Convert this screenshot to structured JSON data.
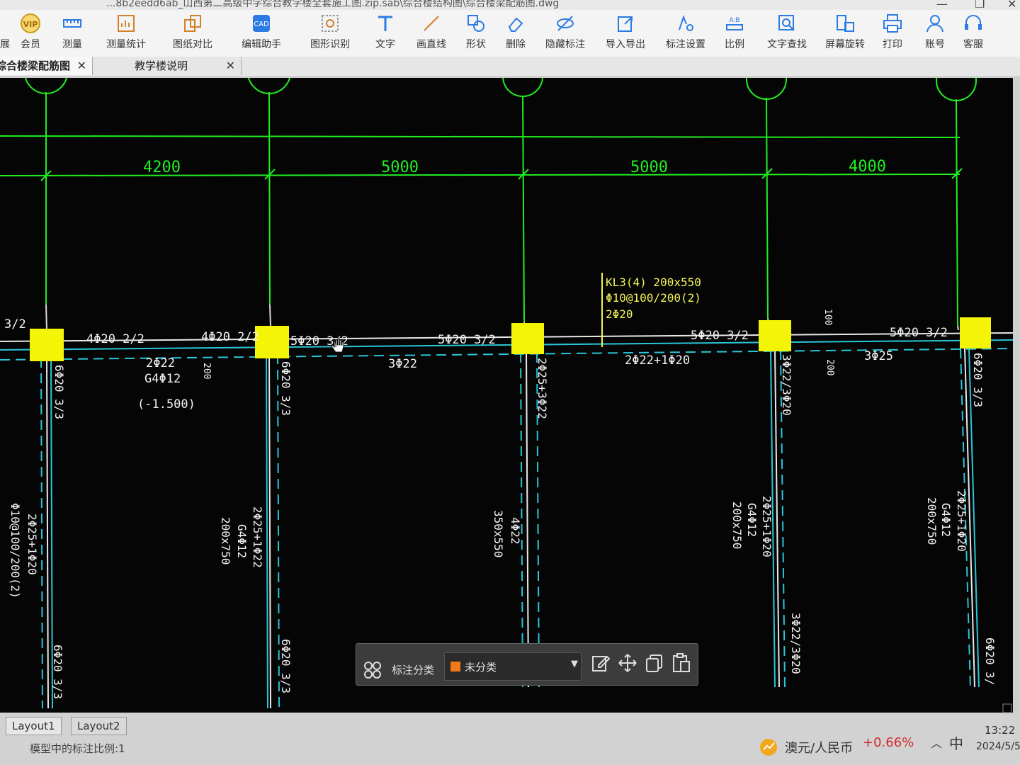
{
  "window": {
    "title": "...8b2eedd6ab_山西第二高级中学综合教学楼全套施工图.zip.sab\\综合楼结构图\\综合楼梁配筋图.dwg"
  },
  "toolbar": {
    "items": [
      {
        "label": "会员",
        "icon": "vip-icon"
      },
      {
        "label": "测量",
        "icon": "ruler-icon"
      },
      {
        "label": "测量统计",
        "icon": "measure-stats-icon"
      },
      {
        "label": "图纸对比",
        "icon": "compare-icon"
      },
      {
        "label": "编辑助手",
        "icon": "edit-assistant-icon"
      },
      {
        "label": "图形识别",
        "icon": "shape-recognize-icon"
      },
      {
        "label": "文字",
        "icon": "text-icon"
      },
      {
        "label": "画直线",
        "icon": "line-icon"
      },
      {
        "label": "形状",
        "icon": "shape-icon"
      },
      {
        "label": "删除",
        "icon": "eraser-icon"
      },
      {
        "label": "隐藏标注",
        "icon": "hide-annotation-icon"
      },
      {
        "label": "导入导出",
        "icon": "import-export-icon"
      },
      {
        "label": "标注设置",
        "icon": "annotation-settings-icon"
      },
      {
        "label": "比例",
        "icon": "scale-icon"
      },
      {
        "label": "文字查找",
        "icon": "text-search-icon"
      },
      {
        "label": "屏幕旋转",
        "icon": "rotate-screen-icon"
      },
      {
        "label": "打印",
        "icon": "print-icon"
      },
      {
        "label": "账号",
        "icon": "account-icon"
      },
      {
        "label": "客服",
        "icon": "headset-icon"
      }
    ],
    "left_partial": "展"
  },
  "tabs": [
    {
      "label": "综合楼梁配筋图",
      "active": true
    },
    {
      "label": "教学楼说明",
      "active": false
    }
  ],
  "drawing": {
    "dimensions": [
      "4200",
      "5000",
      "5000",
      "4000"
    ],
    "beam_label": [
      "KL3(4) 200x550",
      "Φ10@100/200(2)",
      "2Φ20"
    ],
    "top_labels": [
      "3/2",
      "4Φ20 2/2",
      "4Φ20 2/2",
      "5Φ20 3/2",
      "5Φ20 3/2",
      "5Φ20 3/2",
      "5Φ20 3/2"
    ],
    "bottom_labels": [
      "2Φ22",
      "G4Φ12",
      "(-1.500)",
      "3Φ22",
      "2Φ22+1Φ20",
      "3Φ25",
      "200",
      "200",
      "100"
    ],
    "vertical_labels": [
      "6Φ20 3/3",
      "6Φ20 3/3",
      "2Φ25+3Φ22",
      "3Φ22/3Φ20",
      "6Φ20 3/3",
      "2Φ25+1Φ20",
      "Φ10@100/200(2)",
      "2Φ25+1Φ22",
      "G4Φ12",
      "200x750",
      "4Φ22",
      "350x550",
      "2Φ25+1Φ20",
      "G4Φ12",
      "200x750",
      "2Φ25+1Φ20",
      "G4Φ12",
      "200x750",
      "6Φ20 3/3",
      "6Φ20 3/3",
      "3Φ22/3Φ20",
      "6Φ20 3/"
    ]
  },
  "colors": {
    "canvas_bg": "#050505",
    "grid_green": "#22ee22",
    "beam_cyan": "#29c6d8",
    "column_yellow": "#f4f406",
    "text_white": "#ffffff",
    "label_yellow": "#f4f45a"
  },
  "floating_toolbar": {
    "category_label": "标注分类",
    "selected_category": "未分类",
    "swatch_color": "#f07a1a",
    "icons": [
      "grid-icon",
      "edit-note-icon",
      "move-icon",
      "copy-icon",
      "paste-icon"
    ]
  },
  "layouts": [
    "Layout1",
    "Layout2"
  ],
  "status": {
    "scale_text": "模型中的标注比例:1"
  },
  "tray": {
    "ticker": "澳元/人民币",
    "change": "+0.66%",
    "ime": "中",
    "time": "13:22",
    "date": "2024/5/5"
  }
}
